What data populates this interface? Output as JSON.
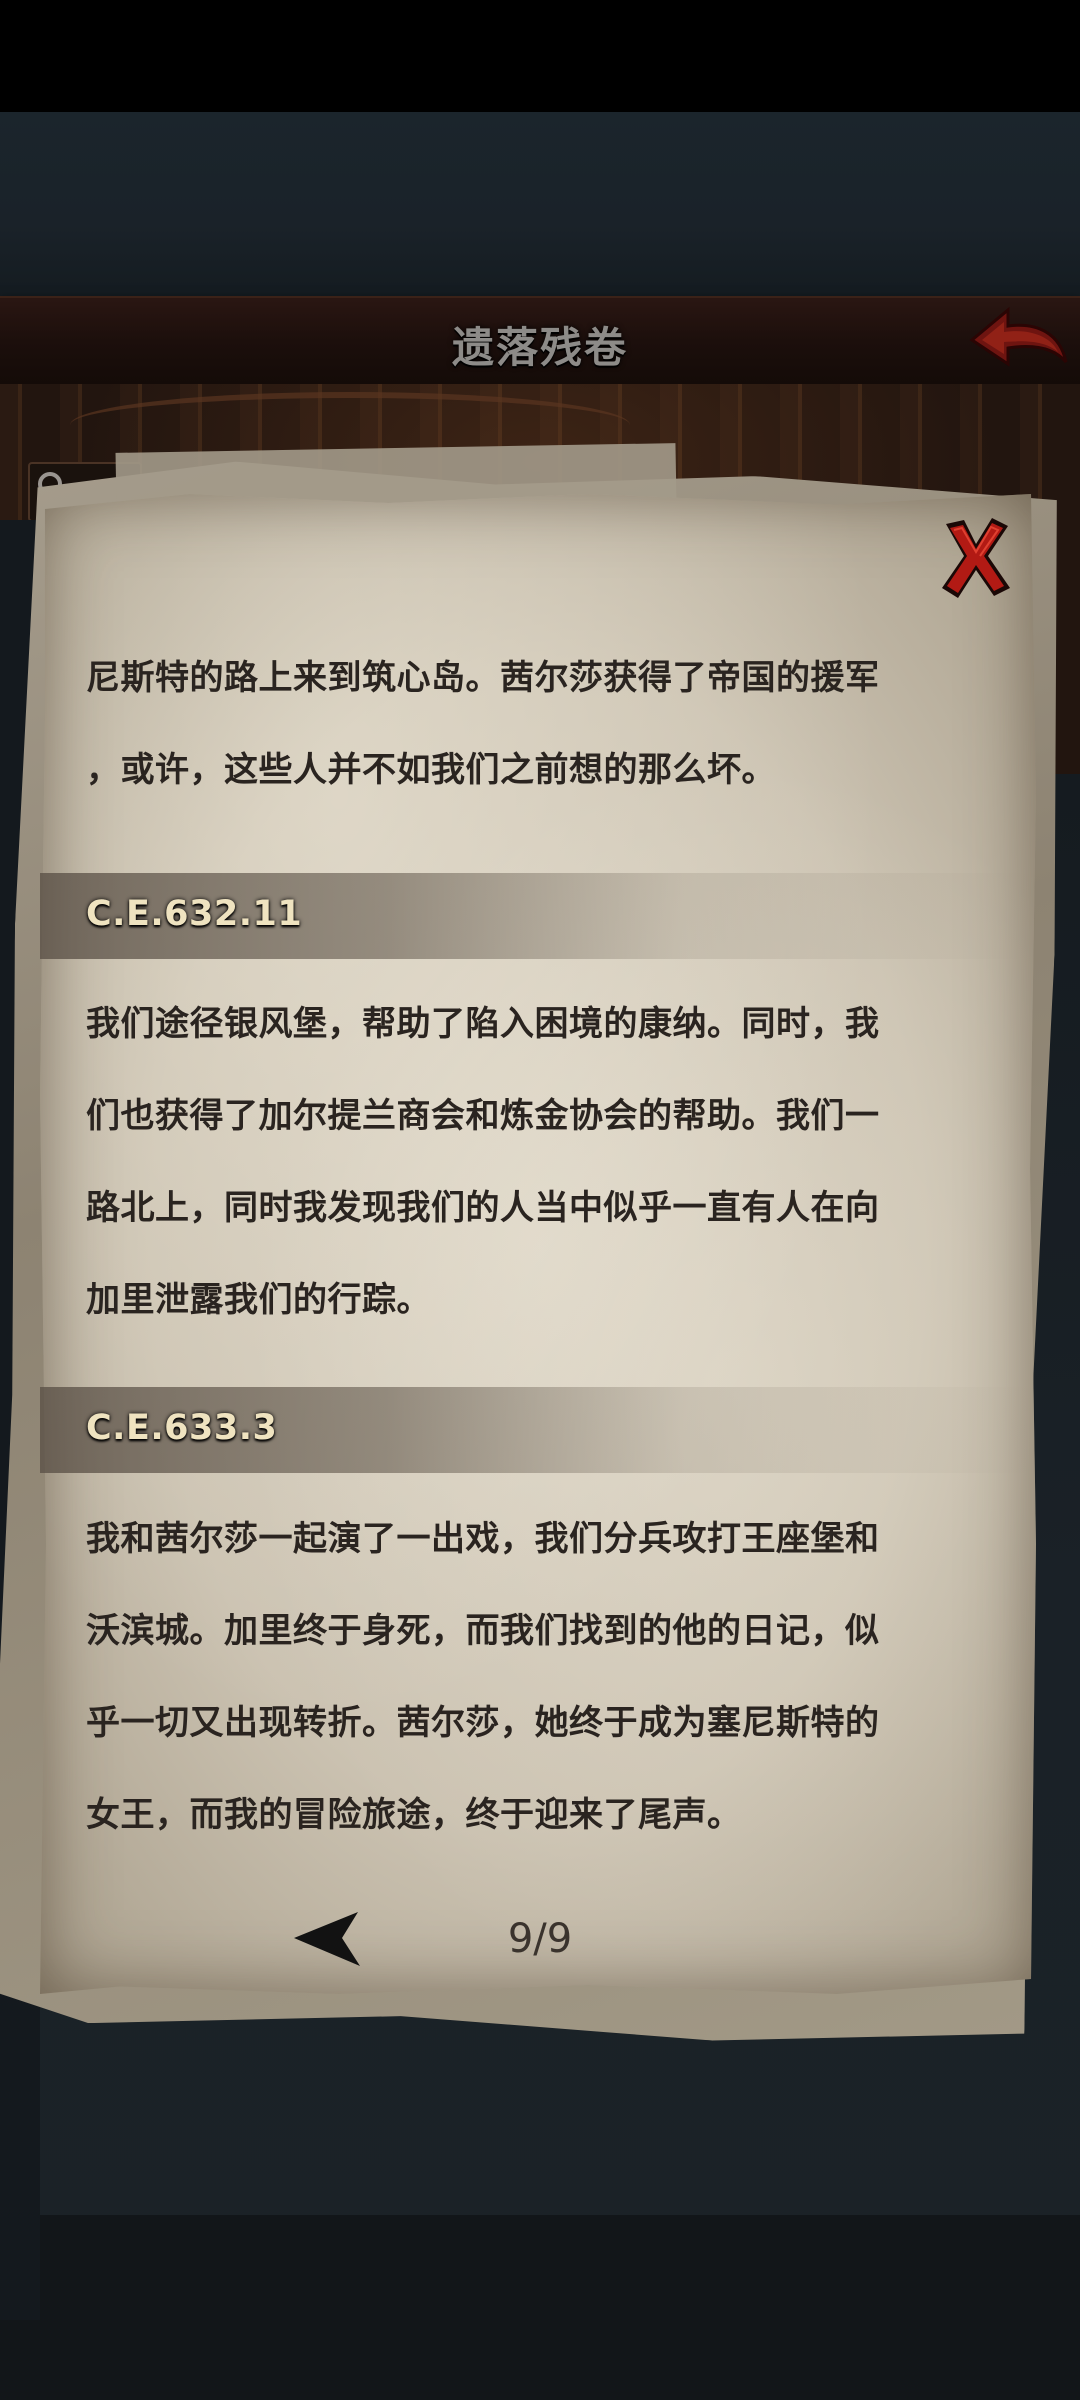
{
  "header": {
    "title": "遗落残卷"
  },
  "icons": {
    "back": "back-arrow-icon",
    "close": "close-x-icon",
    "search": "search-icon",
    "prev_page": "prev-page-arrow-icon"
  },
  "colors": {
    "close_red": "#b21a14",
    "back_arrow_red": "#7a1410",
    "parchment": "#cfc6b5",
    "ink": "#2a2420",
    "date_label": "#efe3c0"
  },
  "scroll": {
    "lines_intro": [
      "尼斯特的路上来到筑心岛。茜尔莎获得了帝国的援军",
      "，或许，这些人并不如我们之前想的那么坏。"
    ],
    "entries": [
      {
        "date": "C.E.632.11",
        "lines": [
          "我们途径银风堡，帮助了陷入困境的康纳。同时，我",
          "们也获得了加尔提兰商会和炼金协会的帮助。我们一",
          "路北上，同时我发现我们的人当中似乎一直有人在向",
          "加里泄露我们的行踪。"
        ]
      },
      {
        "date": "C.E.633.3",
        "lines": [
          "我和茜尔莎一起演了一出戏，我们分兵攻打王座堡和",
          "沃滨城。加里终于身死，而我们找到的他的日记，似",
          "乎一切又出现转折。茜尔莎，她终于成为塞尼斯特的",
          "女王，而我的冒险旅途，终于迎来了尾声。"
        ]
      }
    ]
  },
  "pager": {
    "page": "9/9"
  }
}
